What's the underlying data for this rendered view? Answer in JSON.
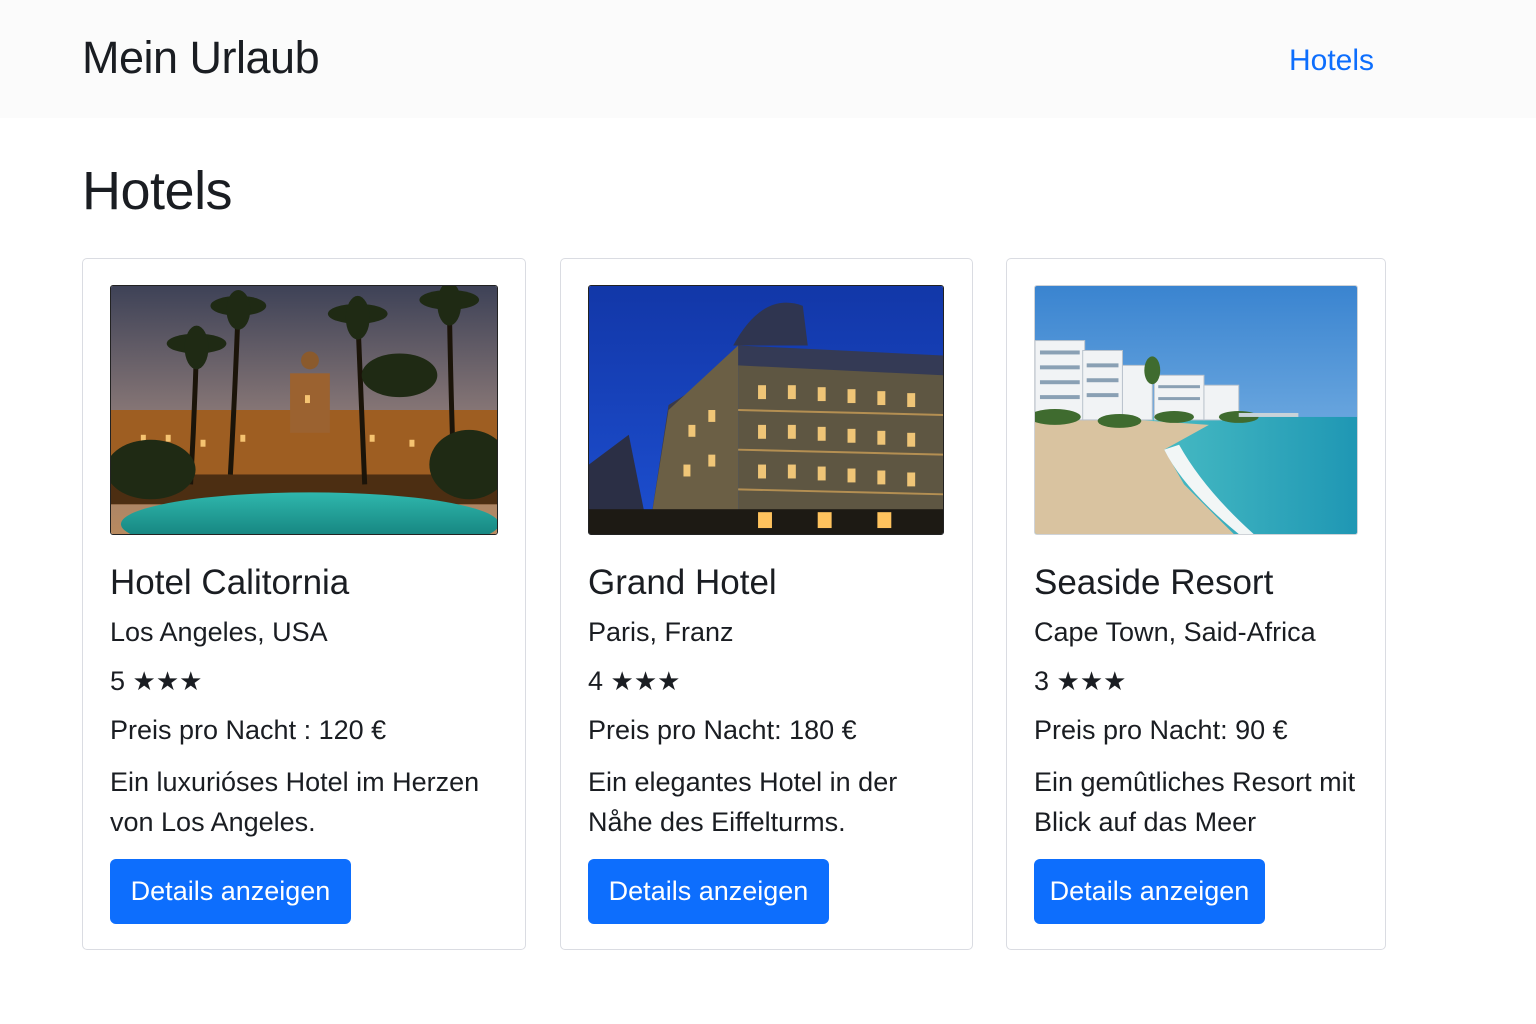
{
  "navbar": {
    "brand": "Mein Urlaub",
    "link": "Hotels"
  },
  "page": {
    "title": "Hotels"
  },
  "hotels": [
    {
      "name": "Hotel Calitornia",
      "location": "Los Angeles, USA",
      "rating": "5",
      "stars": "★★★",
      "price": "Preis pro Nacht : 120 €",
      "description_line1": "Ein luxurióses Hotel im Herzen",
      "description_line2": "von Los Angeles.",
      "button": "Details anzeigen",
      "image": "resort-pool-palms-night-photo"
    },
    {
      "name": "Grand Hotel",
      "location": "Paris, Franz",
      "rating": "4",
      "stars": "★★★",
      "price": "Preis pro Nacht: 180 €",
      "description_line1": "Ein elegantes Hotel in der",
      "description_line2": "Nåhe des Eiffelturms.",
      "button": "Details anzeigen",
      "image": "parisian-hotel-building-night-photo"
    },
    {
      "name": "Seaside Resort",
      "location": "Cape Town, Said-Africa",
      "rating": "3",
      "stars": "★★★",
      "price": "Preis pro Nacht: 90 €",
      "description_line1": "Ein gemûtliches Resort mit",
      "description_line2": "Blick auf das Meer",
      "button": "Details anzeigen",
      "image": "beach-resort-ocean-photo"
    }
  ],
  "colors": {
    "primary": "#0d6efd",
    "navbar_bg": "#fbfbfb",
    "text": "#1a1d22",
    "card_border": "#dadce2"
  }
}
